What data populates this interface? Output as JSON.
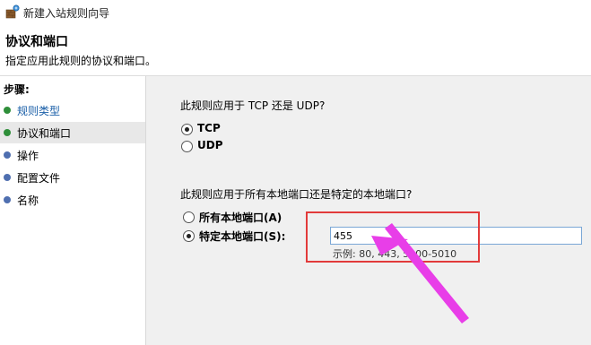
{
  "window": {
    "title": "新建入站规则向导",
    "icon": "firewall-wizard-icon"
  },
  "header": {
    "title": "协议和端口",
    "subtitle": "指定应用此规则的协议和端口。"
  },
  "sidebar": {
    "heading": "步骤:",
    "steps": [
      {
        "label": "规则类型",
        "state": "completed"
      },
      {
        "label": "协议和端口",
        "state": "current"
      },
      {
        "label": "操作",
        "state": "pending"
      },
      {
        "label": "配置文件",
        "state": "pending"
      },
      {
        "label": "名称",
        "state": "pending"
      }
    ]
  },
  "main": {
    "protocol_question": "此规则应用于 TCP 还是 UDP?",
    "protocol_options": [
      {
        "label": "TCP",
        "checked": true
      },
      {
        "label": "UDP",
        "checked": false
      }
    ],
    "port_question": "此规则应用于所有本地端口还是特定的本地端口?",
    "port_options": [
      {
        "label": "所有本地端口(A)",
        "checked": false
      },
      {
        "label": "特定本地端口(S):",
        "checked": true
      }
    ],
    "port_value": "455",
    "example": "示例: 80, 443, 5000-5010"
  },
  "annotation": {
    "box_color": "#e23b3b",
    "arrow_color": "#e83ee8"
  }
}
